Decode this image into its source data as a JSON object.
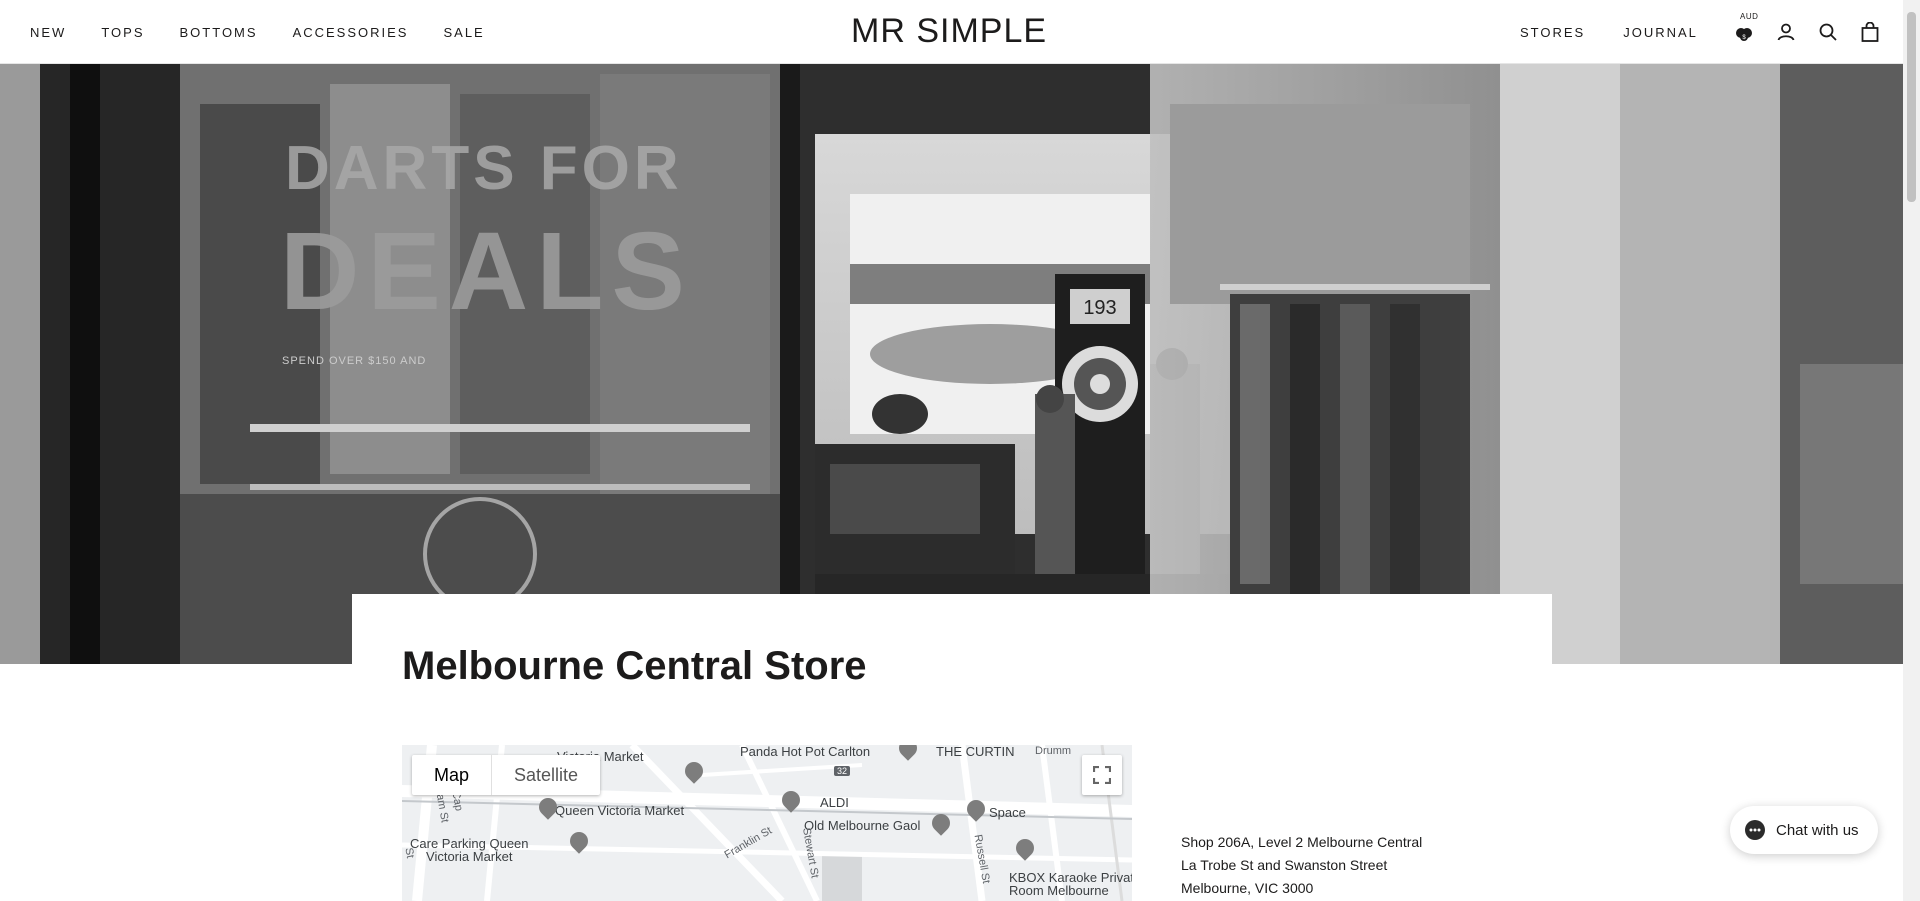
{
  "header": {
    "nav_left": [
      "NEW",
      "TOPS",
      "BOTTOMS",
      "ACCESSORIES",
      "SALE"
    ],
    "logo": "MR SIMPLE",
    "nav_right": [
      "STORES",
      "JOURNAL"
    ],
    "currency": "AUD"
  },
  "hero": {
    "window_text_1": "DARTS FOR",
    "window_text_2": "DEALS",
    "window_small_text": "SPEND OVER $150 AND",
    "scoreboard": "193"
  },
  "store": {
    "title": "Melbourne Central Store"
  },
  "map": {
    "toggle": [
      "Map",
      "Satellite"
    ],
    "labels": {
      "victoria_market": "Victoria Market",
      "panda": "Panda Hot Pot Carlton",
      "curtin": "THE CURTIN",
      "queen_victoria": "Queen Victoria Market",
      "aldi": "ALDI",
      "space": "Space",
      "care_parking": "Care Parking Queen\nVictoria Market",
      "old_gaol": "Old Melbourne Gaol",
      "kbox": "KBOX Karaoke Private\nRoom Melbourne",
      "franklin": "Franklin St",
      "stewart": "Stewart St",
      "russell": "Russell St",
      "route": "32",
      "william": "liam St",
      "cap": "Cap",
      "drummond": "Drumm",
      "st": "St"
    }
  },
  "address": {
    "line1": "Shop 206A, Level 2 Melbourne Central",
    "line2": "La Trobe St and Swanston Street",
    "line3": "Melbourne, VIC 3000"
  },
  "chat": {
    "label": "Chat with us"
  },
  "colors": {
    "text": "#1c1b1b",
    "header_border": "#e6e6e6"
  }
}
